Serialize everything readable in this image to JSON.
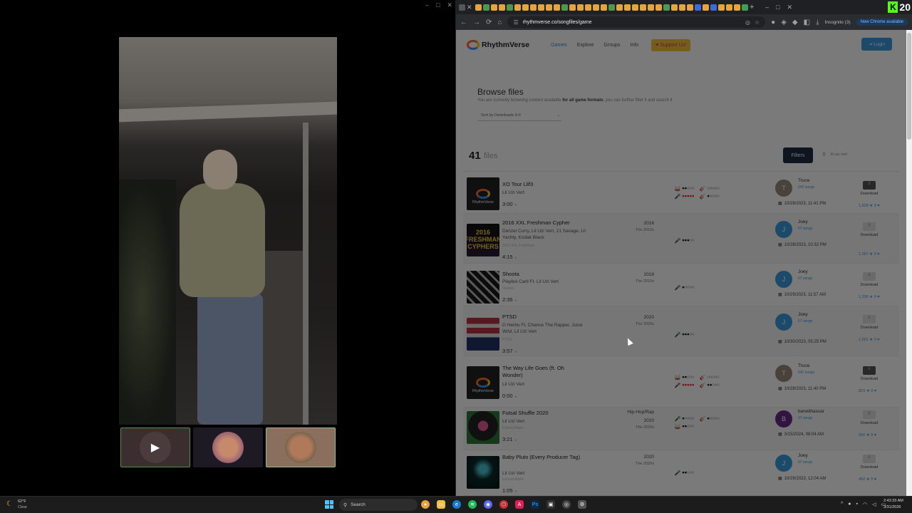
{
  "call": {
    "controls": [
      "–",
      "□",
      "✕"
    ]
  },
  "browser": {
    "url": "rhythmverse.co/songfiles/game",
    "incognito": "Incognito (3)",
    "new_chrome": "New Chrome available"
  },
  "kick": {
    "letter": "K",
    "count": "20"
  },
  "site": {
    "logo": "RhythmVerse",
    "nav": [
      "Games",
      "Explore",
      "Groups",
      "Info"
    ],
    "support": "Support Us!",
    "login": "Login"
  },
  "browse": {
    "title": "Browse files",
    "subtitle_pre": "You are currently browsing content available",
    "subtitle_bold": "for all game formats",
    "subtitle_post": ", you can further filter it and search it",
    "sort": "Sort by Downloads 9-0",
    "count": "41",
    "count_label": "files",
    "filters": "Filters",
    "search_value": "lil uzi vert"
  },
  "rows": [
    {
      "title": "XO Tour Llif3",
      "artist": "Lil Uzi Vert",
      "album": "",
      "duration": "3:00",
      "year": "",
      "decade": "",
      "genre": "",
      "uploader": "Truce",
      "songs": "242 songs",
      "date": "10/28/2023, 11:41 PM",
      "download": "Download",
      "stats": "1,828 ★  0 ♥"
    },
    {
      "title": "2016 XXL Freshman Cypher",
      "artist": "Denzel Curry, Lil Uzi Vert, 21 Savage, Lil Yachty, Kodak Black",
      "album": "2016 XXL Freshman",
      "duration": "4:15",
      "year": "2016",
      "decade": "The 2010s",
      "genre": "",
      "uploader": "Joey",
      "songs": "67 songs",
      "date": "10/28/2023, 10:32 PM",
      "download": "Download",
      "stats": "1,367 ★  0 ♥",
      "art_text": "2016 FRESHMAN CYPHERS"
    },
    {
      "title": "Shoota",
      "artist": "Playboi Carti Ft. Lil Uzi Vert",
      "album": "Shoota",
      "duration": "2:35",
      "year": "2018",
      "decade": "The 2010s",
      "genre": "",
      "uploader": "Joey",
      "songs": "67 songs",
      "date": "10/29/2023, 11:57 AM",
      "download": "Download",
      "stats": "1,296 ★  0 ♥"
    },
    {
      "title": "PTSD",
      "artist": "G Herbo Ft. Chance The Rapper, Juice Wrld, Lil Uzi Vert",
      "album": "PTSD",
      "duration": "3:57",
      "year": "2020",
      "decade": "The 2020s",
      "genre": "",
      "uploader": "Joey",
      "songs": "67 songs",
      "date": "10/30/2023, 05:25 PM",
      "download": "Download",
      "stats": "1,001 ★  0 ♥"
    },
    {
      "title": "The Way Life Goes (ft. Oh Wonder)",
      "artist": "Lil Uzi Vert",
      "album": "",
      "duration": "0:00",
      "year": "",
      "decade": "",
      "genre": "",
      "uploader": "Truce",
      "songs": "242 songs",
      "date": "10/28/2023, 11:40 PM",
      "download": "Download",
      "stats": "823 ★  0 ♥"
    },
    {
      "title": "Futsal Shuffle 2020",
      "artist": "Lil Uzi Vert",
      "album": "Eternal Atake",
      "duration": "3:21",
      "year": "2020",
      "decade": "The 2020s",
      "genre": "Hip-Hop/Rap",
      "uploader": "barwithascar",
      "songs": "37 songs",
      "date": "3/15/2024, 08:04 AM",
      "download": "Download",
      "stats": "500 ★  0 ♥"
    },
    {
      "title": "Baby Pluto (Every Producer Tag)",
      "artist": "Lil Uzi Vert",
      "album": "Eternal Atake",
      "duration": "1:05",
      "year": "2020",
      "decade": "The 2020s",
      "genre": "",
      "uploader": "Joey",
      "songs": "67 songs",
      "date": "10/29/2023, 12:04 AM",
      "download": "Download",
      "stats": "492 ★  0 ♥"
    }
  ],
  "taskbar": {
    "temp": "62°F",
    "condition": "Clear",
    "search": "Search",
    "time": "2:43:33 AM",
    "date": "3/31/2026"
  },
  "colors": {
    "accent": "#3a9be0",
    "support": "#f7c23c",
    "kick": "#53fc18",
    "filters": "#1f2a44"
  }
}
